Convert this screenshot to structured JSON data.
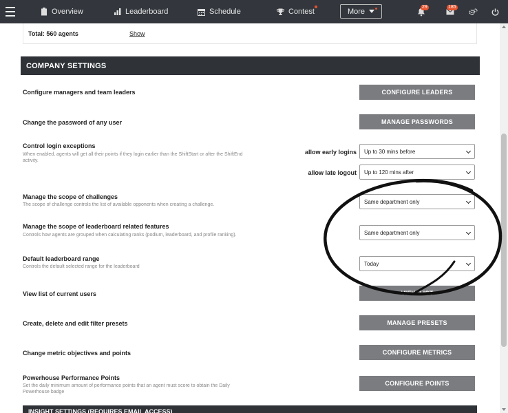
{
  "nav": {
    "items": [
      {
        "label": "Overview",
        "icon": "clipboard-icon",
        "glyph": "▮"
      },
      {
        "label": "Leaderboard",
        "icon": "bar-chart-icon",
        "glyph": "▮"
      },
      {
        "label": "Schedule",
        "icon": "calendar-icon",
        "glyph": "▦"
      },
      {
        "label": "Contest",
        "icon": "trophy-icon",
        "glyph": "🏆"
      }
    ],
    "more_label": "More",
    "notifications_count": "29",
    "messages_count": "185",
    "accent": "#e8532e"
  },
  "summary": {
    "total_label": "Total: 560 agents",
    "show_link": "Show"
  },
  "section": {
    "title": "COMPANY SETTINGS"
  },
  "rows": {
    "configure_leaders": {
      "title": "Configure managers and team leaders",
      "button": "CONFIGURE LEADERS"
    },
    "manage_passwords": {
      "title": "Change the password of any user",
      "button": "MANAGE PASSWORDS"
    },
    "login_exceptions": {
      "title": "Control login exceptions",
      "desc": "When enabled, agents will get all their points if they login earlier than the ShiftStart or after the ShiftEnd activity.",
      "early_label": "allow early logins",
      "early_value": "Up to 30 mins before",
      "late_label": "allow late logout",
      "late_value": "Up to 120 mins after"
    },
    "challenge_scope": {
      "title": "Manage the scope of challenges",
      "desc": "The scope of challenge controls the list of available opponents when creating a challenge.",
      "value": "Same department only"
    },
    "leaderboard_scope": {
      "title": "Manage the scope of leaderboard related features",
      "desc": "Controls how agents are grouped when calculating ranks (podium, leaderboard, and profile ranking).",
      "value": "Same department only"
    },
    "leaderboard_range": {
      "title": "Default leaderboard range",
      "desc": "Controls the default selected range for the leaderboard",
      "value": "Today"
    },
    "view_users": {
      "title": "View list of current users",
      "button": "VIEW LIST"
    },
    "filter_presets": {
      "title": "Create, delete and edit filter presets",
      "button": "MANAGE PRESETS"
    },
    "metrics": {
      "title": "Change metric objectives and points",
      "button": "CONFIGURE METRICS"
    },
    "performance_points": {
      "title": "Powerhouse Performance Points",
      "desc": "Set the daily minimum amount of performance points that an agent must score to obtain the Daily Powerhouse badge",
      "button": "CONFIGURE POINTS"
    }
  },
  "next_section": {
    "title": "INSIGHT SETTINGS (REQUIRES EMAIL ACCESS)"
  }
}
